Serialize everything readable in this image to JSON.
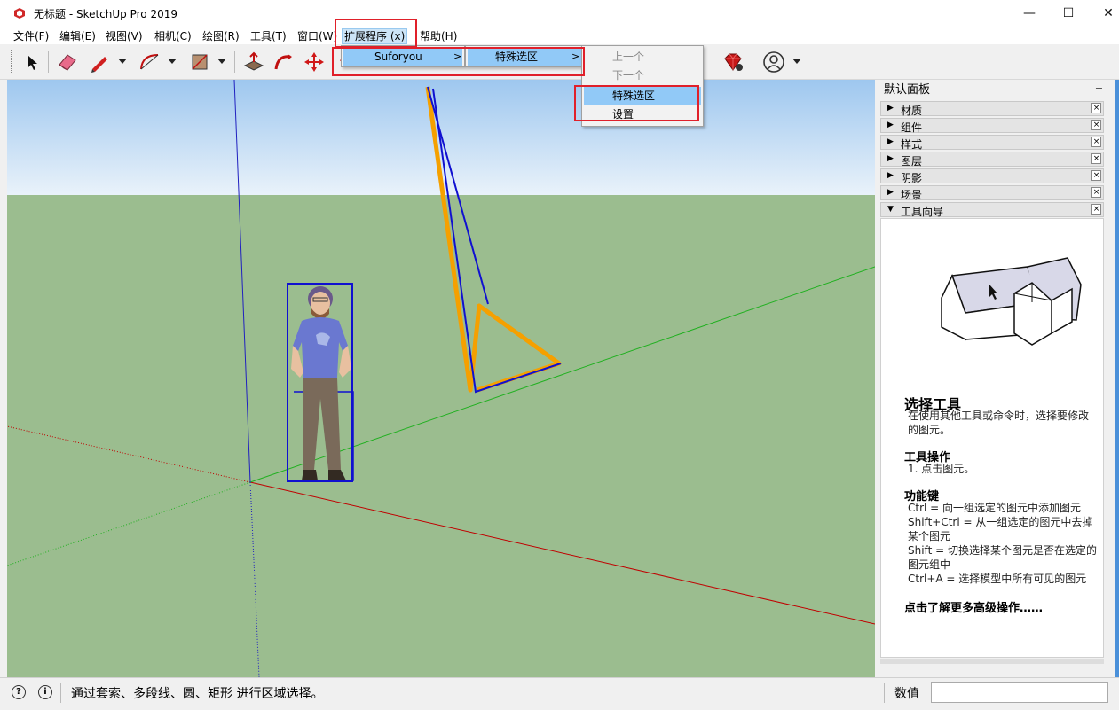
{
  "window": {
    "title": "无标题 - SketchUp Pro 2019",
    "minimize_glyph": "—",
    "maximize_glyph": "☐",
    "close_glyph": "✕"
  },
  "menubar": {
    "items": [
      {
        "label": "文件(F)"
      },
      {
        "label": "编辑(E)"
      },
      {
        "label": "视图(V)"
      },
      {
        "label": "相机(C)"
      },
      {
        "label": "绘图(R)"
      },
      {
        "label": "工具(T)"
      },
      {
        "label": "窗口(W)"
      },
      {
        "label": "扩展程序 (x)"
      },
      {
        "label": "帮助(H)"
      }
    ]
  },
  "toolbar": {
    "icons": [
      "select-arrow-icon",
      "eraser-icon",
      "pencil-line-icon",
      "arc-icon",
      "shape-rect-icon",
      "push-pull-icon",
      "follow-me-icon",
      "move-icon",
      "paint-bucket-icon",
      "ruby-gem-icon",
      "user-account-icon"
    ]
  },
  "extensions_menu": {
    "items": [
      {
        "label": "Suforyou",
        "arrow": ">"
      }
    ]
  },
  "suforyou_submenu": {
    "items": [
      {
        "label": "特殊选区",
        "arrow": ">"
      }
    ]
  },
  "special_select_submenu": {
    "items": [
      {
        "label": "上一个",
        "disabled": true
      },
      {
        "label": "下一个",
        "disabled": true
      },
      {
        "label": "特殊选区",
        "highlighted": true
      },
      {
        "label": "设置"
      }
    ]
  },
  "panel": {
    "title": "默认面板",
    "pin_glyph": "⊥",
    "trays": [
      {
        "label": "材质",
        "expanded": false
      },
      {
        "label": "组件",
        "expanded": false
      },
      {
        "label": "样式",
        "expanded": false
      },
      {
        "label": "图层",
        "expanded": false
      },
      {
        "label": "阴影",
        "expanded": false
      },
      {
        "label": "场景",
        "expanded": false
      },
      {
        "label": "工具向导",
        "expanded": true
      }
    ],
    "close_glyph": "×",
    "collapsed_glyph": "▶",
    "expanded_glyph": "▼",
    "instructor": {
      "title": "选择工具",
      "desc": "在使用其他工具或命令时，选择要修改的图元。",
      "ops_title": "工具操作",
      "ops": "1. 点击图元。",
      "keys_title": "功能键",
      "keys": [
        "Ctrl = 向一组选定的图元中添加图元",
        "Shift+Ctrl = 从一组选定的图元中去掉某个图元",
        "Shift = 切换选择某个图元是否在选定的图元组中",
        "Ctrl+A = 选择模型中所有可见的图元"
      ],
      "more": "点击了解更多高级操作……"
    }
  },
  "statusbar": {
    "hint": "通过套索、多段线、圆、矩形 进行区域选择。",
    "values_label": "数值",
    "values_input": "",
    "geo_glyph": "?",
    "info_glyph": "i"
  },
  "colors": {
    "sky_top": "#9ec7ef",
    "sky_bottom": "#e9f2fa",
    "ground": "#9bbd8f",
    "selection_blue": "#1010d0",
    "highlight_orange": "#f5a000",
    "axis_red": "#c00000",
    "axis_green": "#20b020",
    "axis_blue": "#2020c0",
    "callout_red": "#e0202a"
  }
}
